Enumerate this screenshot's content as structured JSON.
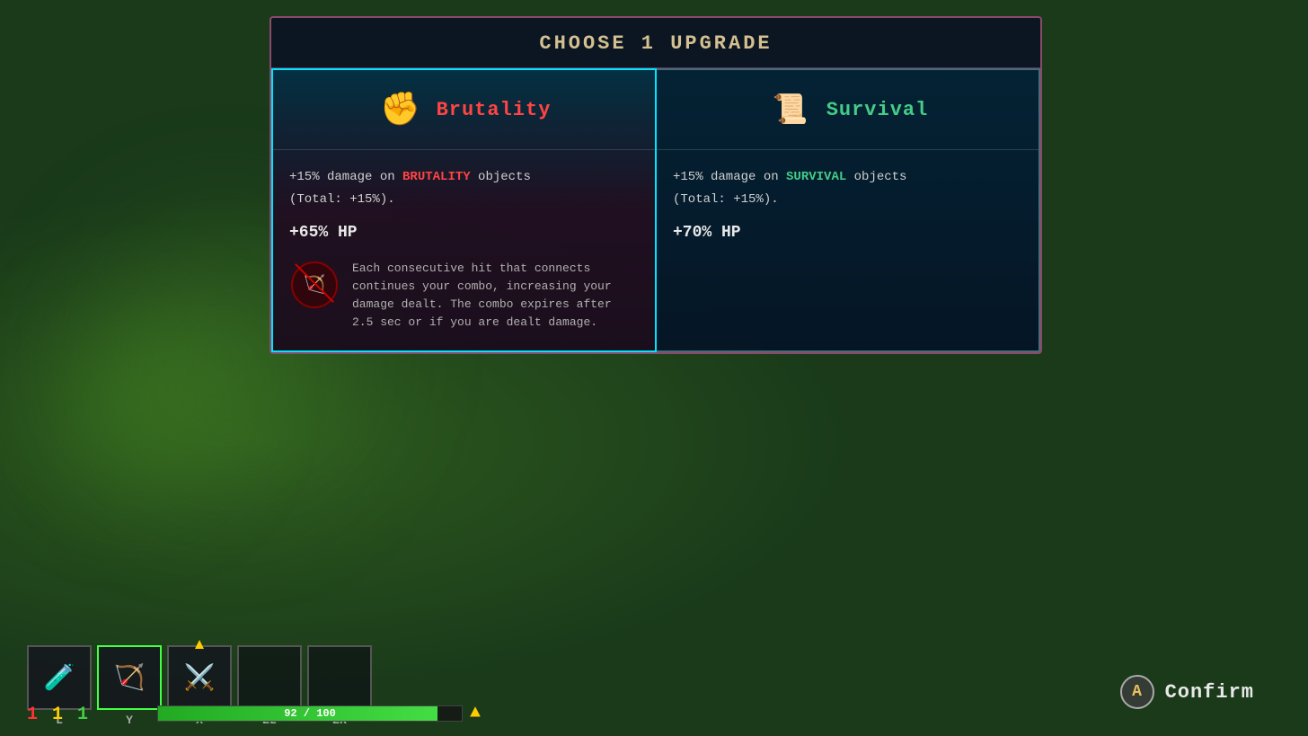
{
  "background": {
    "color": "#1a3a1a"
  },
  "dialog": {
    "title": "CHOOSE 1 UPGRADE",
    "cards": [
      {
        "id": "brutality",
        "name": "Brutality",
        "type": "brutality",
        "selected": true,
        "stat_damage": "+15% damage on ",
        "stat_damage_keyword": "BRUTALITY",
        "stat_damage_suffix": " objects",
        "stat_total": "(Total: +15%).",
        "stat_hp": "+65% HP",
        "ability_text": "Each consecutive hit that connects continues your combo, increasing your damage dealt. The combo expires after 2.5 sec or if you are dealt damage."
      },
      {
        "id": "survival",
        "name": "Survival",
        "type": "survival",
        "selected": false,
        "stat_damage": "+15% damage on ",
        "stat_damage_keyword": "SURVIVAL",
        "stat_damage_suffix": " objects",
        "stat_total": "(Total: +15%).",
        "stat_hp": "+70% HP",
        "ability_text": ""
      }
    ]
  },
  "hotbar": {
    "slots": [
      {
        "key": "L",
        "has_item": true,
        "selected": false,
        "icon": "🧪"
      },
      {
        "key": "Y",
        "has_item": true,
        "selected": true,
        "icon": "🏹"
      },
      {
        "key": "X",
        "has_item": true,
        "selected": false,
        "icon": "⚔️",
        "has_pip": true
      },
      {
        "key": "ZL",
        "has_item": false,
        "selected": false,
        "icon": ""
      },
      {
        "key": "ZR",
        "has_item": false,
        "selected": false,
        "icon": ""
      }
    ],
    "stats": {
      "red": "1",
      "yellow": "1",
      "green": "1"
    },
    "hp_current": "92",
    "hp_max": "100",
    "hp_percent": 92
  },
  "confirm_button": {
    "key_label": "A",
    "label": "Confirm"
  }
}
